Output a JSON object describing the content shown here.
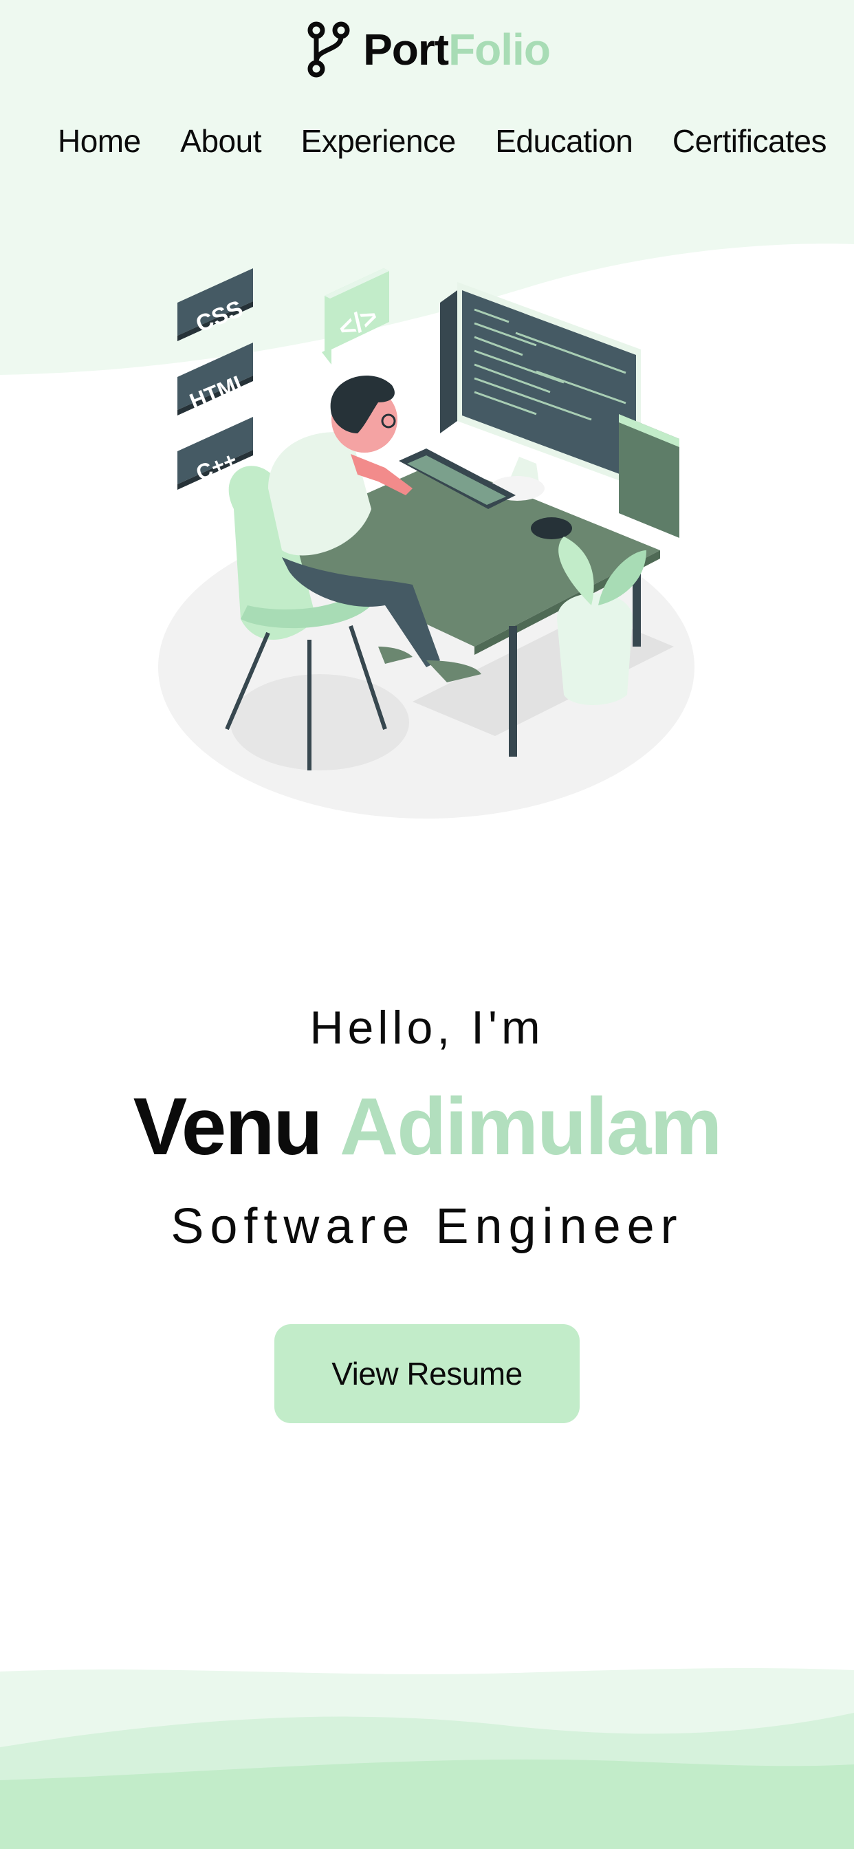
{
  "brand": {
    "logo_icon": "git-branch-icon",
    "name_part1": "Port",
    "name_part2": "Folio"
  },
  "nav": {
    "items": [
      {
        "label": "Home"
      },
      {
        "label": "About"
      },
      {
        "label": "Experience"
      },
      {
        "label": "Education"
      },
      {
        "label": "Certificates"
      }
    ]
  },
  "hero": {
    "illustration": {
      "badges": [
        "CSS",
        "HTML",
        "C++"
      ],
      "code_bubble": "</>"
    },
    "greeting": "Hello, I'm",
    "first_name": "Venu",
    "last_name": "Adimulam",
    "title": "Software Engineer",
    "resume_button": "View Resume"
  },
  "colors": {
    "accent": "#b2dfbe",
    "button": "#c2ecc9",
    "top_background": "#eef9f0",
    "text": "#0b0b0b"
  }
}
